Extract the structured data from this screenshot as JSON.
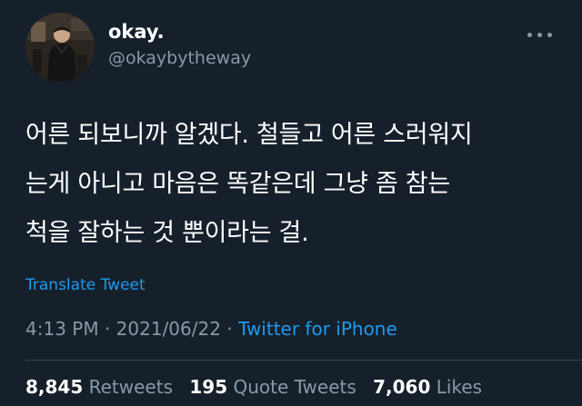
{
  "user": {
    "display_name": "okay.",
    "handle": "@okaybytheway",
    "avatar_icon": "profile-photo"
  },
  "more_icon": "more-horizontal-icon",
  "tweet": {
    "lines": [
      "어른 되보니까 알겠다. 철들고 어른 스러워지",
      "는게 아니고 마음은 똑같은데 그냥 좀 참는",
      "척을 잘하는 것 뿐이라는 걸."
    ],
    "translate_label": "Translate Tweet"
  },
  "meta": {
    "time": "4:13 PM",
    "separator": " · ",
    "date": "2021/06/22",
    "source": "Twitter for iPhone"
  },
  "stats": {
    "retweets_count": "8,845",
    "retweets_label": "Retweets",
    "quotes_count": "195",
    "quotes_label": "Quote Tweets",
    "likes_count": "7,060",
    "likes_label": "Likes"
  },
  "colors": {
    "background": "#15202b",
    "text": "#ffffff",
    "secondary": "#8b98a5",
    "accent": "#1d9bf0",
    "divider": "#38444d"
  }
}
